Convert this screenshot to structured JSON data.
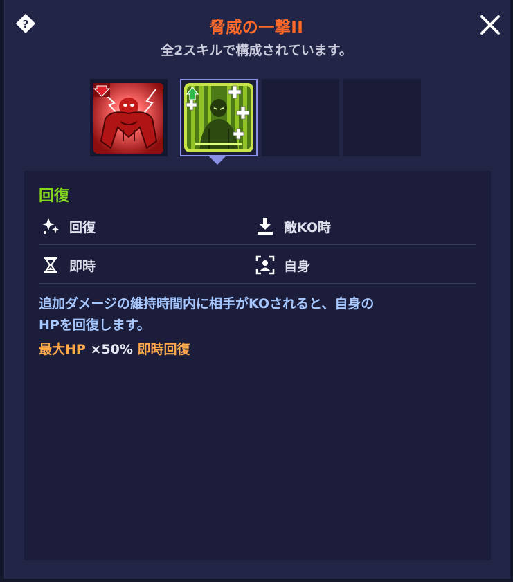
{
  "header": {
    "title": "脅威の一撃II",
    "subtitle": "全2スキルで構成されています。"
  },
  "icons": {
    "help": "help-diamond-icon",
    "close": "close-icon"
  },
  "skills": [
    {
      "name": "red-brute-skill-icon",
      "badge": "debuff-down-arrow",
      "selected": false
    },
    {
      "name": "green-recovery-skill-icon",
      "badge": "buff-up-arrow",
      "selected": true
    },
    {
      "name": "empty-slot",
      "selected": false
    },
    {
      "name": "empty-slot",
      "selected": false
    }
  ],
  "detail": {
    "category": "回復",
    "attributes": [
      {
        "icon": "heal-sparkle-icon",
        "label": "回復"
      },
      {
        "icon": "download-tray-icon",
        "label": "敵KO時"
      },
      {
        "icon": "hourglass-icon",
        "label": "即時"
      },
      {
        "icon": "self-target-icon",
        "label": "自身"
      }
    ],
    "description_line1": "追加ダメージの維持時間内に相手がKOされると、自身の",
    "description_line2": "HPを回復します。",
    "effect": {
      "stat": "最大HP",
      "value": "×50%",
      "type": "即時回復"
    }
  },
  "colors": {
    "title": "#ff6a2a",
    "category": "#84d61c",
    "description": "#a7c8ff",
    "effect_highlight": "#ffa94a",
    "selected_border": "#8a90e6"
  }
}
